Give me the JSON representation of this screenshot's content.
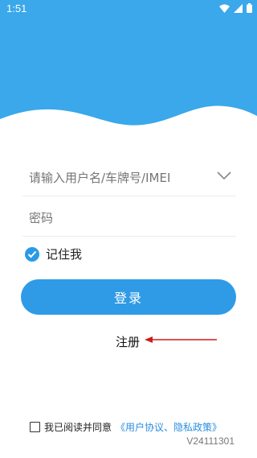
{
  "status_bar": {
    "time": "1:51",
    "icons": [
      "wifi-icon",
      "signal-icon",
      "battery-icon"
    ]
  },
  "colors": {
    "header_blue": "#3aa8ea",
    "button_blue": "#2f9be6",
    "link_blue": "#2a8ee0",
    "arrow_red": "#d11a1a"
  },
  "form": {
    "username_placeholder": "请输入用户名/车牌号/IMEI",
    "password_placeholder": "密码",
    "remember_label": "记住我",
    "remember_checked": true,
    "login_label": "登录",
    "register_label": "注册"
  },
  "footer": {
    "agree_text": "我已阅读并同意",
    "agree_link": "《用户协议、隐私政策》",
    "agree_checked": false,
    "version": "V24111301"
  }
}
